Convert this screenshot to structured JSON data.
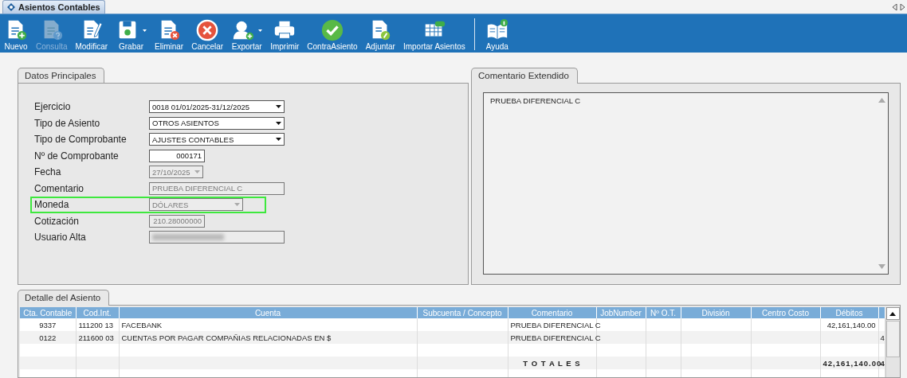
{
  "window": {
    "title": "Asientos Contables"
  },
  "toolbar": [
    {
      "kind": "button",
      "label": "Nuevo",
      "disabled": false,
      "dropdown": false
    },
    {
      "kind": "button",
      "label": "Consulta",
      "disabled": true,
      "dropdown": false
    },
    {
      "kind": "button",
      "label": "Modificar",
      "disabled": false,
      "dropdown": false
    },
    {
      "kind": "button",
      "label": "Grabar",
      "disabled": false,
      "dropdown": true
    },
    {
      "kind": "button",
      "label": "Eliminar",
      "disabled": false,
      "dropdown": false
    },
    {
      "kind": "button",
      "label": "Cancelar",
      "disabled": false,
      "dropdown": false
    },
    {
      "kind": "button",
      "label": "Exportar",
      "disabled": false,
      "dropdown": true
    },
    {
      "kind": "button",
      "label": "Imprimir",
      "disabled": false,
      "dropdown": false
    },
    {
      "kind": "button",
      "label": "ContraAsiento",
      "disabled": false,
      "dropdown": false
    },
    {
      "kind": "button",
      "label": "Adjuntar",
      "disabled": false,
      "dropdown": false
    },
    {
      "kind": "button",
      "label": "Importar Asientos",
      "disabled": false,
      "dropdown": false
    },
    {
      "kind": "separator"
    },
    {
      "kind": "button",
      "label": "Ayuda",
      "disabled": false,
      "dropdown": false
    }
  ],
  "main_panel": {
    "tab": "Datos Principales",
    "fields": [
      {
        "label": "Ejercicio",
        "kind": "select",
        "value": "0018 01/01/2025-31/12/2025",
        "disabled": false
      },
      {
        "label": "Tipo de Asiento",
        "kind": "select",
        "value": "OTROS ASIENTOS",
        "disabled": false
      },
      {
        "label": "Tipo de Comprobante",
        "kind": "select",
        "value": "AJUSTES CONTABLES",
        "disabled": false
      },
      {
        "label": "Nº de Comprobante",
        "kind": "number",
        "value": "000171",
        "disabled": false
      },
      {
        "label": "Fecha",
        "kind": "date",
        "value": "27/10/2025",
        "disabled": true
      },
      {
        "label": "Comentario",
        "kind": "text",
        "value": "PRUEBA DIFERENCIAL C",
        "disabled": true
      },
      {
        "label": "Moneda",
        "kind": "select",
        "value": "DÓLARES",
        "disabled": true
      },
      {
        "label": "Cotización",
        "kind": "number",
        "value": "210.28000000",
        "disabled": true
      },
      {
        "label": "Usuario Alta",
        "kind": "redacted",
        "disabled": true
      }
    ]
  },
  "comment_panel": {
    "tab": "Comentario Extendido",
    "value": "PRUEBA DIFERENCIAL C"
  },
  "detail": {
    "tab": "Detalle del Asiento",
    "columns": [
      "Cta. Contable",
      "Cod.Int.",
      "Cuenta",
      "Subcuenta / Concepto",
      "Comentario",
      "JobNumber",
      "Nº O.T.",
      "División",
      "Centro Costo",
      "Débitos"
    ],
    "rows": [
      {
        "cta_contable": "9337",
        "cod_int": "111200 13",
        "cuenta": "FACEBANK",
        "comentario": "PRUEBA DIFERENCIAL C",
        "debitos": "42,161,140.00"
      },
      {
        "cta_contable": "0122",
        "cod_int": "211600 03",
        "cuenta": "CUENTAS POR PAGAR COMPAÑIAS RELACIONADAS EN $",
        "comentario": "PRUEBA DIFERENCIAL C",
        "column_11": "4"
      }
    ],
    "totals": {
      "label": "T O T A L E S",
      "debitos": "42,161,140.00",
      "column_11": "4"
    }
  }
}
